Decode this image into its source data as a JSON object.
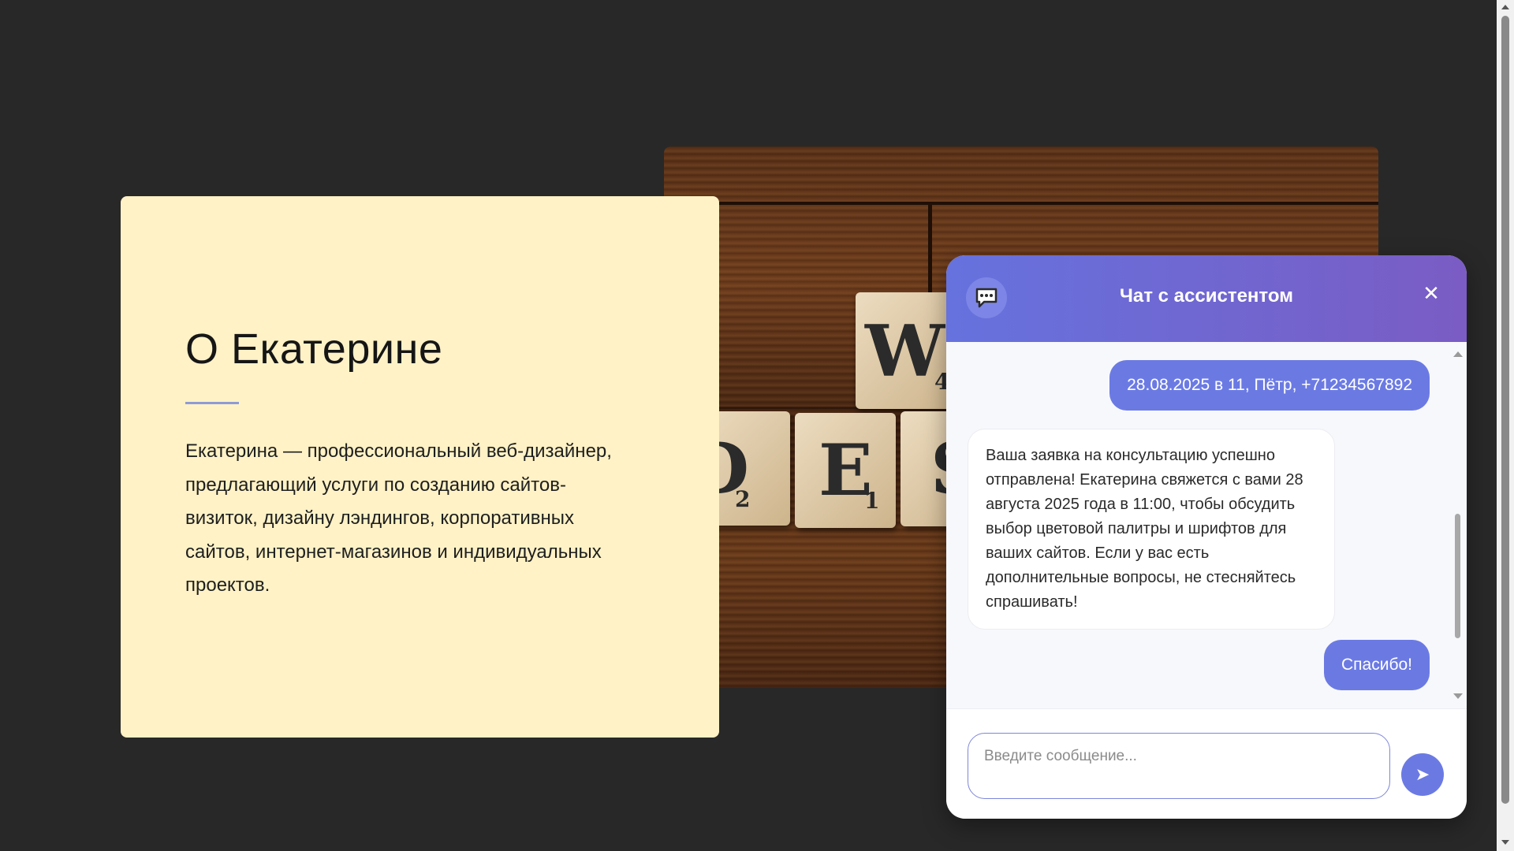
{
  "about": {
    "title": "О Екатерине",
    "text": "Екатерина — профессиональный веб-дизайнер, предлагающий услуги по созданию сайтов-визиток, дизайну лэндингов, корпоративных сайтов, интернет-магазинов и индивидуальных проектов."
  },
  "photo": {
    "tiles": [
      {
        "letter": "W",
        "score": "4"
      },
      {
        "letter": "D",
        "score": "2"
      },
      {
        "letter": "E",
        "score": "1"
      },
      {
        "letter": "S",
        "score": ""
      }
    ]
  },
  "chat": {
    "title": "Чат с ассистентом",
    "icon": "chat-bubble-icon",
    "close_label": "✕",
    "messages": [
      {
        "role": "user",
        "text": "28.08.2025 в 11, Пётр, +71234567892"
      },
      {
        "role": "assistant",
        "text": "Ваша заявка на консультацию успешно отправлена! Екатерина свяжется с вами 28 августа 2025 года в 11:00, чтобы обсудить выбор цветовой палитры и шрифтов для ваших сайтов. Если у вас есть дополнительные вопросы, не стесняйтесь спрашивать!"
      },
      {
        "role": "user",
        "text": "Спасибо!"
      }
    ],
    "input_placeholder": "Введите сообщение...",
    "send_icon": "➤"
  },
  "colors": {
    "page_bg": "#282828",
    "card_bg": "#fff2c6",
    "accent": "#6b7ae3",
    "header_gradient_start": "#6672de",
    "header_gradient_end": "#7a5cc4"
  }
}
